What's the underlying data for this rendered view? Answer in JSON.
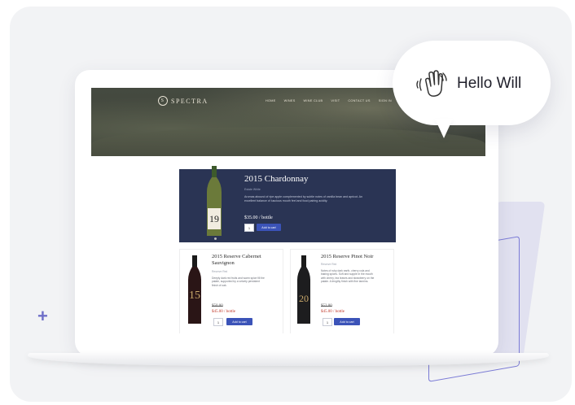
{
  "site": {
    "brand": "SPECTRA",
    "nav": [
      "HOME",
      "WINES",
      "WINE CLUB",
      "VISIT",
      "CONTACT US",
      "SIGN IN"
    ]
  },
  "featured": {
    "title": "2015 Chardonnay",
    "subtitle": "Estate White",
    "description": "Aromas abound of ripe apple complemented by subtle notes of vanilla bean and apricot. An excellent balance of luscious mouth feel and food pairing acidity.",
    "price": "$35.00 / bottle",
    "qty": "1",
    "add_label": "Add to cart",
    "bottle_number": "19"
  },
  "products": [
    {
      "title": "2015 Reserve Cabernet Sauvignon",
      "subtitle": "Reserve Red",
      "description": "Deeply dark red fruits and warm spice fill the palate, supported by a velvety persistent finish of oak.",
      "old_price": "$50.00",
      "price": "$45.00 / bottle",
      "qty": "1",
      "add_label": "Add to cart",
      "bottle_number": "15"
    },
    {
      "title": "2015 Reserve Pinot Noir",
      "subtitle": "Reserve Red",
      "description": "Notes of ruby dark earth, cherry cola and baking spices. Soft and supple in the mouth with cherry, tea leaves and strawberry on the palate. A lengthy finish with fine tannins.",
      "old_price": "$52.00",
      "price": "$45.00 / bottle",
      "qty": "1",
      "add_label": "Add to cart",
      "bottle_number": "20"
    }
  ],
  "bubble": {
    "greeting": "Hello Will",
    "icon": "waving-hand-icon"
  },
  "colors": {
    "navy": "#2a3454",
    "button": "#3b53b8",
    "accent": "#6f6fc8"
  }
}
